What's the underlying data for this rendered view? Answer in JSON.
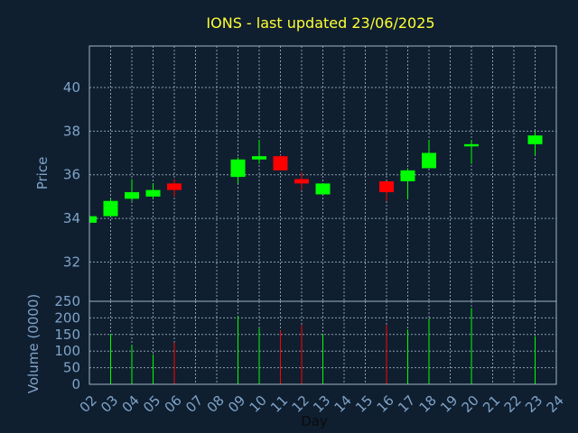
{
  "chart_data": {
    "type": "candlestick",
    "title": "IONS - last updated 23/06/2025",
    "xlabel": "Day",
    "price_ylabel": "Price",
    "volume_ylabel": "Volume (0000)",
    "x_ticks": [
      "02",
      "03",
      "04",
      "05",
      "06",
      "07",
      "08",
      "09",
      "10",
      "11",
      "12",
      "13",
      "14",
      "15",
      "16",
      "17",
      "18",
      "19",
      "20",
      "21",
      "22",
      "23",
      "24"
    ],
    "price_ylim": [
      30.2,
      41.9
    ],
    "price_yticks": [
      "32",
      "34",
      "36",
      "38",
      "40"
    ],
    "volume_ylim": [
      0,
      250
    ],
    "volume_yticks": [
      "0",
      "50",
      "100",
      "150",
      "200",
      "250"
    ],
    "candles": [
      {
        "day": "02",
        "open": 33.8,
        "close": 34.1,
        "high": 34.1,
        "low": 33.8,
        "up": true,
        "volume": 0
      },
      {
        "day": "03",
        "open": 34.1,
        "close": 34.8,
        "high": 34.9,
        "low": 34.1,
        "up": true,
        "volume": 152
      },
      {
        "day": "04",
        "open": 34.9,
        "close": 35.2,
        "high": 35.8,
        "low": 34.8,
        "up": true,
        "volume": 118
      },
      {
        "day": "05",
        "open": 35.0,
        "close": 35.3,
        "high": 35.6,
        "low": 34.9,
        "up": true,
        "volume": 90
      },
      {
        "day": "06",
        "open": 35.6,
        "close": 35.3,
        "high": 35.8,
        "low": 35.0,
        "up": false,
        "volume": 126
      },
      {
        "day": "09",
        "open": 35.9,
        "close": 36.7,
        "high": 36.8,
        "low": 35.6,
        "up": true,
        "volume": 205
      },
      {
        "day": "10",
        "open": 36.7,
        "close": 36.85,
        "high": 37.6,
        "low": 36.5,
        "up": true,
        "volume": 168
      },
      {
        "day": "11",
        "open": 36.85,
        "close": 36.2,
        "high": 36.9,
        "low": 36.2,
        "up": false,
        "volume": 162
      },
      {
        "day": "12",
        "open": 35.8,
        "close": 35.6,
        "high": 36.1,
        "low": 35.3,
        "up": false,
        "volume": 178
      },
      {
        "day": "13",
        "open": 35.1,
        "close": 35.6,
        "high": 35.6,
        "low": 35.1,
        "up": true,
        "volume": 152
      },
      {
        "day": "16",
        "open": 35.7,
        "close": 35.2,
        "high": 35.7,
        "low": 34.8,
        "up": false,
        "volume": 178
      },
      {
        "day": "17",
        "open": 35.7,
        "close": 36.2,
        "high": 36.3,
        "low": 34.9,
        "up": true,
        "volume": 165
      },
      {
        "day": "18",
        "open": 36.3,
        "close": 37.0,
        "high": 37.6,
        "low": 36.3,
        "up": true,
        "volume": 198
      },
      {
        "day": "20",
        "open": 37.3,
        "close": 37.4,
        "high": 37.6,
        "low": 36.5,
        "up": true,
        "volume": 230
      },
      {
        "day": "23",
        "open": 37.4,
        "close": 37.8,
        "high": 38.0,
        "low": 36.9,
        "up": true,
        "volume": 145
      }
    ],
    "colors": {
      "up": "#00ff00",
      "down": "#ff0000",
      "title": "#ffff33",
      "axis_text": "#7fa3c8",
      "background": "#0f1f30"
    },
    "grid": true
  }
}
